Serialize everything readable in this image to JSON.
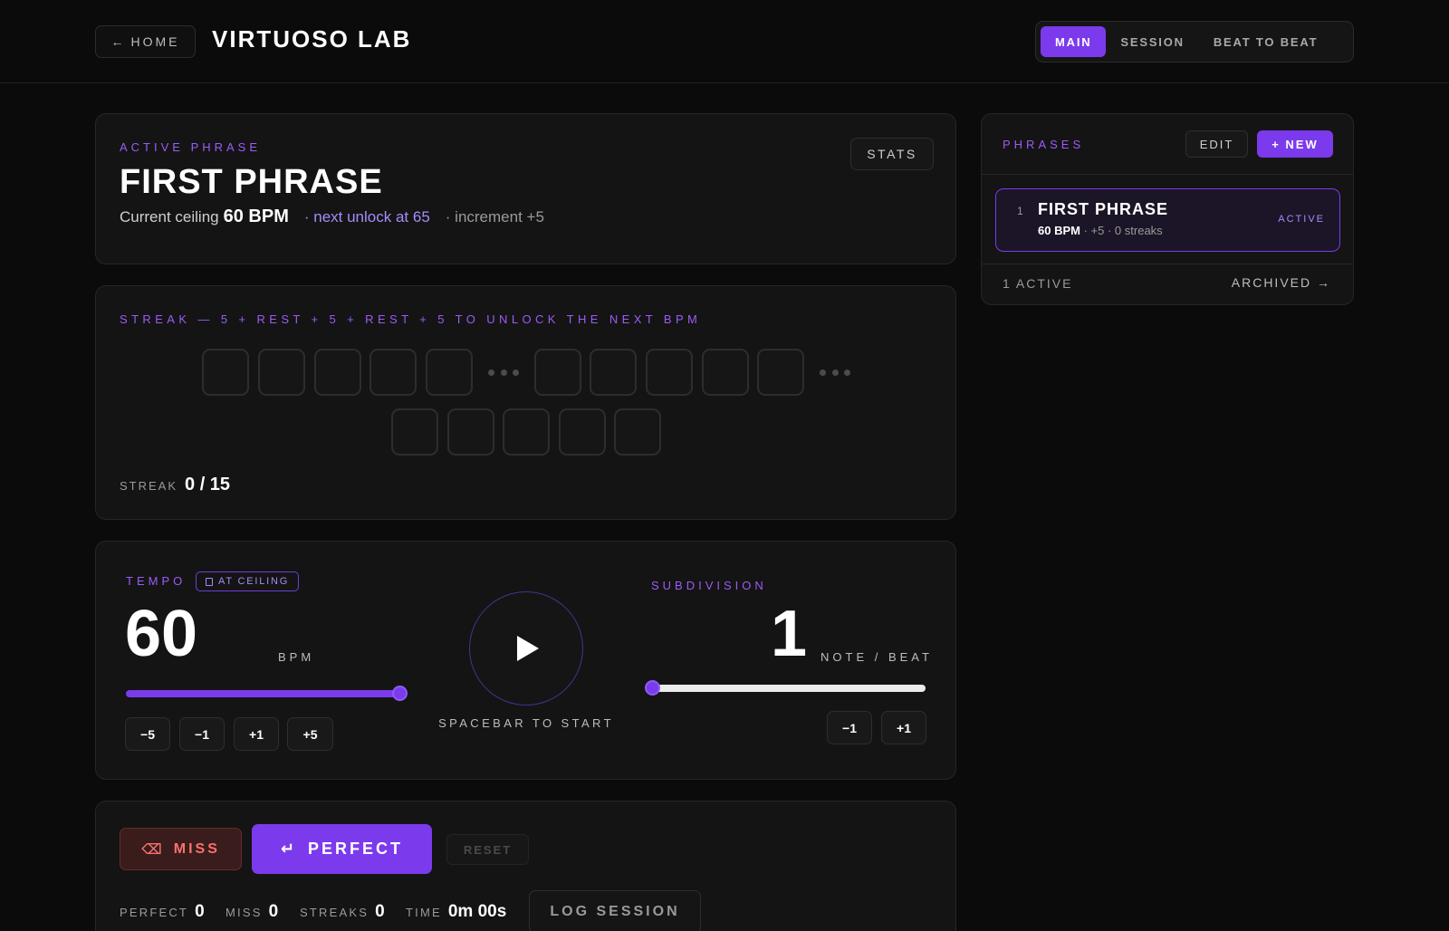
{
  "header": {
    "home_label": "HOME",
    "home_arrow": "←",
    "title": "VIRTUOSO LAB",
    "tabs": [
      {
        "label": "MAIN",
        "active": true
      },
      {
        "label": "SESSION",
        "active": false
      },
      {
        "label": "BEAT TO BEAT",
        "active": false
      }
    ]
  },
  "active_phrase": {
    "eyebrow": "ACTIVE PHRASE",
    "title": "FIRST PHRASE",
    "ceiling_prefix": "Current ceiling",
    "ceiling_value": "60 BPM",
    "next_unlock": "· next unlock at 65",
    "increment": "· increment +5",
    "stats_label": "STATS"
  },
  "streak": {
    "eyebrow": "STREAK — 5 + REST + 5 + REST + 5 TO UNLOCK THE NEXT BPM",
    "count_label": "STREAK",
    "count_value": "0 / 15",
    "completed": 0,
    "total": 15
  },
  "tempo": {
    "eyebrow": "TEMPO",
    "badge": "AT CEILING",
    "value": "60",
    "unit": "BPM",
    "slider_fraction": 1.0,
    "steps": [
      "−5",
      "−1",
      "+1",
      "+5"
    ]
  },
  "transport": {
    "hint": "SPACEBAR TO START"
  },
  "subdivision": {
    "eyebrow": "SUBDIVISION",
    "value": "1",
    "unit": "NOTE / BEAT",
    "slider_fraction": 0.0,
    "steps": [
      "−1",
      "+1"
    ]
  },
  "actions": {
    "miss_label": "MISS",
    "miss_icon": "⌫",
    "perfect_label": "PERFECT",
    "perfect_icon": "↵",
    "reset_label": "RESET",
    "log_label": "LOG SESSION",
    "metrics": [
      {
        "label": "PERFECT",
        "value": "0"
      },
      {
        "label": "MISS",
        "value": "0"
      },
      {
        "label": "STREAKS",
        "value": "0"
      },
      {
        "label": "TIME",
        "value": "0m 00s"
      }
    ]
  },
  "phrases_panel": {
    "eyebrow": "PHRASES",
    "edit_label": "EDIT",
    "new_label": "+ NEW",
    "items": [
      {
        "num": "1",
        "name": "FIRST PHRASE",
        "bpm": "60 BPM",
        "inc": "· +5",
        "streaks": "· 0 streaks",
        "status": "ACTIVE"
      }
    ],
    "footer_left": "1 ACTIVE",
    "footer_right": "ARCHIVED →"
  },
  "colors": {
    "accent": "#7c3aed",
    "accent_text": "#a78bfa",
    "miss": "#f87171",
    "background": "#0b0b0b",
    "card": "#141414"
  }
}
